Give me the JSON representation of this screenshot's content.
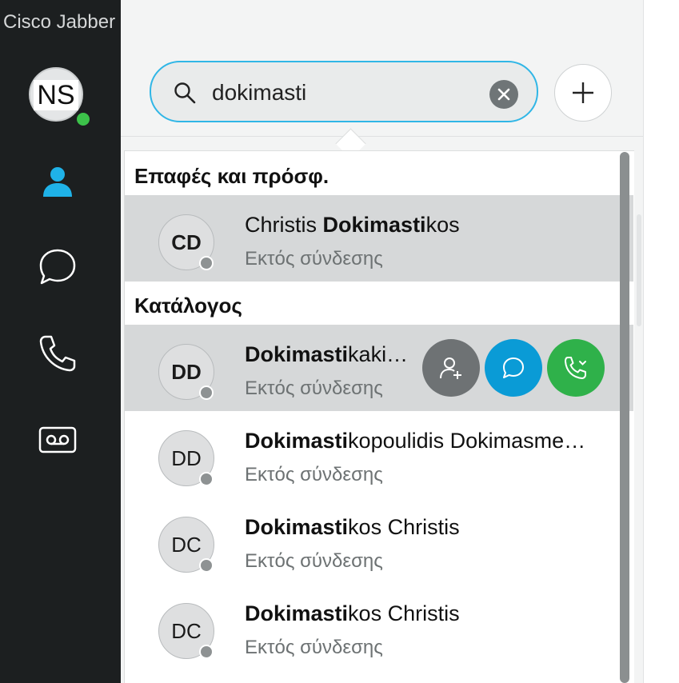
{
  "app": {
    "title": "Cisco Jabber"
  },
  "user": {
    "initials": "NS",
    "presence": "online"
  },
  "nav": [
    {
      "icon": "contacts-icon",
      "active": true
    },
    {
      "icon": "chat-icon",
      "active": false
    },
    {
      "icon": "phone-icon",
      "active": false
    },
    {
      "icon": "voicemail-icon",
      "active": false
    }
  ],
  "search": {
    "value": "dokimasti",
    "placeholder": ""
  },
  "sections": {
    "contacts": "Επαφές και πρόσφ.",
    "directory": "Κατάλογος"
  },
  "results": {
    "contacts": [
      {
        "initials": "CD",
        "name_pre": "Christis ",
        "name_match": "Dokimasti",
        "name_post": "kos",
        "status": "Εκτός σύνδεσης"
      }
    ],
    "directory": [
      {
        "initials": "DD",
        "name_pre": "",
        "name_match": "Dokimasti",
        "name_post": "kaki…",
        "status": "Εκτός σύνδεσης"
      },
      {
        "initials": "DD",
        "name_pre": "",
        "name_match": "Dokimasti",
        "name_post": "kopoulidis Dokimasme…",
        "status": "Εκτός σύνδεσης"
      },
      {
        "initials": "DC",
        "name_pre": "",
        "name_match": "Dokimasti",
        "name_post": "kos Christis",
        "status": "Εκτός σύνδεσης"
      },
      {
        "initials": "DC",
        "name_pre": "",
        "name_match": "Dokimasti",
        "name_post": "kos Christis",
        "status": "Εκτός σύνδεσης"
      }
    ]
  },
  "row_actions": [
    {
      "icon": "add-contact-icon",
      "color": "#6e7274"
    },
    {
      "icon": "chat-icon",
      "color": "#0a9bd6"
    },
    {
      "icon": "call-icon",
      "color": "#2fb14a"
    }
  ],
  "colors": {
    "rail_bg": "#1c1f20",
    "accent": "#30b6e6",
    "online": "#3cc24a",
    "offline": "#8e9293"
  }
}
